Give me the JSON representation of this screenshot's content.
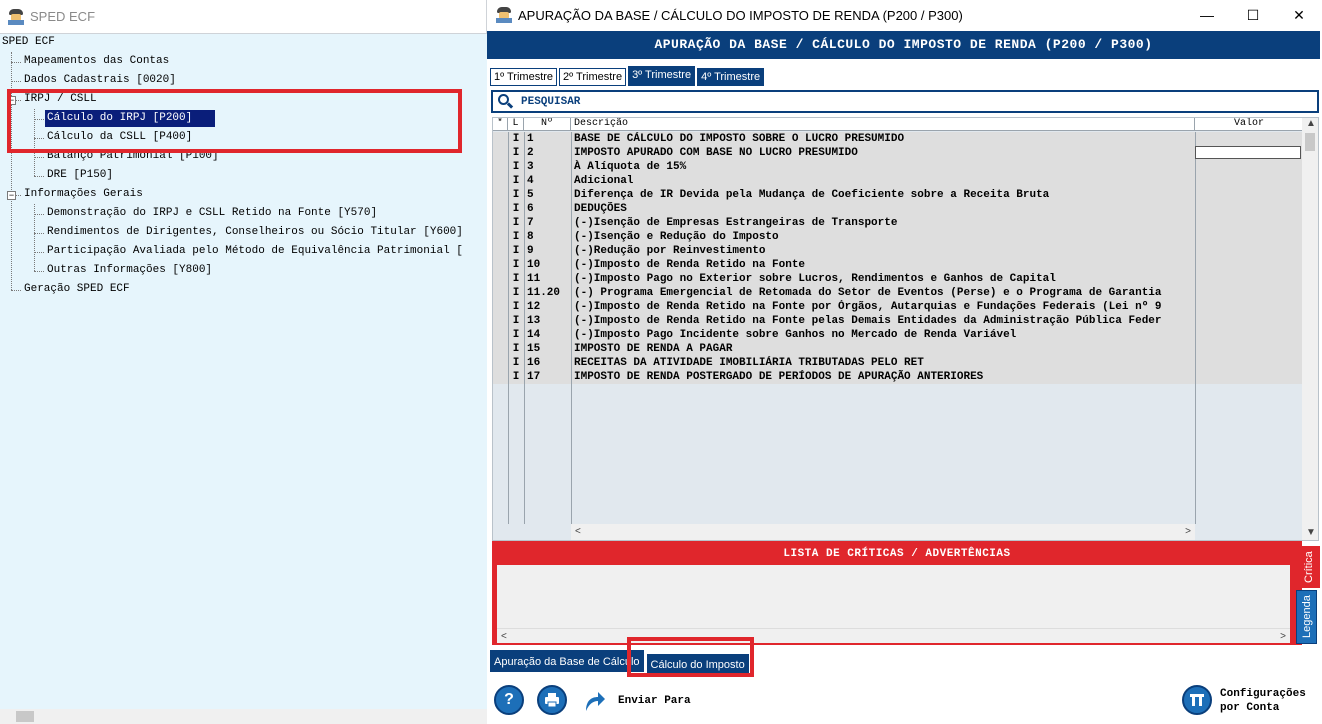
{
  "left_window": {
    "title": "SPED ECF",
    "tree": [
      {
        "label": "SPED ECF"
      },
      {
        "label": "Mapeamentos das Contas"
      },
      {
        "label": "Dados Cadastrais [0020]"
      },
      {
        "label": "IRPJ / CSLL"
      },
      {
        "label": "Cálculo do IRPJ [P200]"
      },
      {
        "label": "Cálculo da CSLL [P400]"
      },
      {
        "label": "Balanço Patrimonial [P100]"
      },
      {
        "label": "DRE [P150]"
      },
      {
        "label": "Informações Gerais"
      },
      {
        "label": "Demonstração do IRPJ e CSLL Retido na Fonte [Y570]"
      },
      {
        "label": "Rendimentos de Dirigentes, Conselheiros ou Sócio Titular [Y600]"
      },
      {
        "label": "Participação Avaliada pelo Método de Equivalência Patrimonial ["
      },
      {
        "label": "Outras Informações [Y800]"
      },
      {
        "label": "Geração SPED ECF"
      }
    ],
    "expander_collapse": "−"
  },
  "right_window": {
    "title": "APURAÇÃO DA BASE / CÁLCULO DO IMPOSTO DE RENDA (P200 / P300)",
    "banner": "APURAÇÃO DA BASE / CÁLCULO DO IMPOSTO DE RENDA (P200 / P300)",
    "window_buttons": {
      "minimize": "—",
      "maximize": "☐",
      "close": "✕"
    },
    "tabs": [
      "1º Trimestre",
      "2º Trimestre",
      "3º Trimestre",
      "4º Trimestre"
    ],
    "search_label": "PESQUISAR",
    "grid": {
      "headers": {
        "star": "*",
        "l": "L",
        "n": "Nº",
        "desc": "Descrição",
        "valor": "Valor"
      },
      "rows": [
        {
          "l": "I",
          "n": "1",
          "desc": "BASE DE CÁLCULO DO IMPOSTO SOBRE O LUCRO PRESUMIDO"
        },
        {
          "l": "I",
          "n": "2",
          "desc": "IMPOSTO APURADO COM BASE NO LUCRO PRESUMIDO"
        },
        {
          "l": "I",
          "n": "3",
          "desc": "À Alíquota de 15%"
        },
        {
          "l": "I",
          "n": "4",
          "desc": "Adicional"
        },
        {
          "l": "I",
          "n": "5",
          "desc": "Diferença de IR Devida pela Mudança de Coeficiente sobre a Receita Bruta"
        },
        {
          "l": "I",
          "n": "6",
          "desc": "DEDUÇÕES"
        },
        {
          "l": "I",
          "n": "7",
          "desc": "(-)Isenção de Empresas Estrangeiras de Transporte"
        },
        {
          "l": "I",
          "n": "8",
          "desc": "(-)Isenção e Redução do Imposto"
        },
        {
          "l": "I",
          "n": "9",
          "desc": "(-)Redução por Reinvestimento"
        },
        {
          "l": "I",
          "n": "10",
          "desc": "(-)Imposto de Renda Retido na Fonte"
        },
        {
          "l": "I",
          "n": "11",
          "desc": "(-)Imposto Pago no Exterior sobre Lucros, Rendimentos e Ganhos de Capital"
        },
        {
          "l": "I",
          "n": "11.20",
          "desc": "(-) Programa Emergencial de Retomada do Setor de Eventos (Perse) e o Programa de Garantia"
        },
        {
          "l": "I",
          "n": "12",
          "desc": "(-)Imposto de Renda Retido na Fonte por Órgãos, Autarquias e Fundações Federais (Lei nº 9"
        },
        {
          "l": "I",
          "n": "13",
          "desc": "(-)Imposto de Renda Retido na Fonte pelas Demais Entidades da Administração Pública Feder"
        },
        {
          "l": "I",
          "n": "14",
          "desc": "(-)Imposto Pago Incidente sobre Ganhos no Mercado de Renda Variável"
        },
        {
          "l": "I",
          "n": "15",
          "desc": "IMPOSTO DE RENDA A PAGAR"
        },
        {
          "l": "I",
          "n": "16",
          "desc": "RECEITAS DA ATIVIDADE IMOBILIÁRIA TRIBUTADAS PELO RET"
        },
        {
          "l": "I",
          "n": "17",
          "desc": "IMPOSTO DE RENDA POSTERGADO DE PERÍODOS DE APURAÇÃO ANTERIORES"
        }
      ]
    },
    "critics": {
      "title": "LISTA DE CRÍTICAS / ADVERTÊNCIAS",
      "side_tabs": [
        "Crítica",
        "Legenda"
      ]
    },
    "bottom_tabs": [
      "Apuração da Base de Cálculo",
      "Cálculo do Imposto"
    ],
    "actions": {
      "help": "?",
      "send_label": "Enviar Para",
      "config_label_1": "Configurações",
      "config_label_2": "por Conta"
    }
  },
  "colors": {
    "accent": "#0a3f7c",
    "highlight": "#e0262c",
    "selection": "#0a1e7a"
  }
}
